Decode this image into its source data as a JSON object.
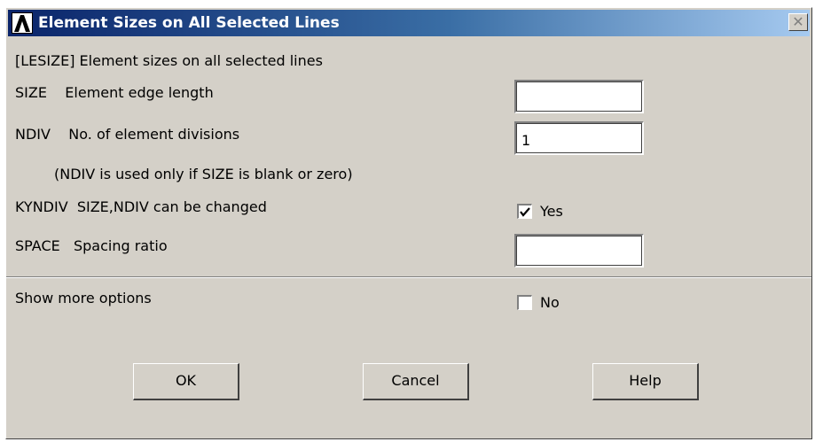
{
  "window": {
    "title": "Element Sizes on All Selected Lines",
    "close_label": "✕"
  },
  "header": "[LESIZE]  Element sizes on all selected lines",
  "size": {
    "label": "SIZE    Element edge length",
    "value": ""
  },
  "ndiv": {
    "label": "NDIV    No. of element divisions",
    "value": "1"
  },
  "note": "(NDIV is used only if SIZE is blank or zero)",
  "kyndiv": {
    "label": "KYNDIV  SIZE,NDIV can be changed",
    "checked": true,
    "state_label": "Yes"
  },
  "space": {
    "label": "SPACE   Spacing ratio",
    "value": ""
  },
  "more_options": {
    "label": "Show more options",
    "checked": false,
    "state_label": "No"
  },
  "buttons": {
    "ok": "OK",
    "cancel": "Cancel",
    "help": "Help"
  },
  "colors": {
    "title_start": "#0a246a",
    "title_end": "#a6caf0",
    "dialog_bg": "#d4d0c8"
  }
}
